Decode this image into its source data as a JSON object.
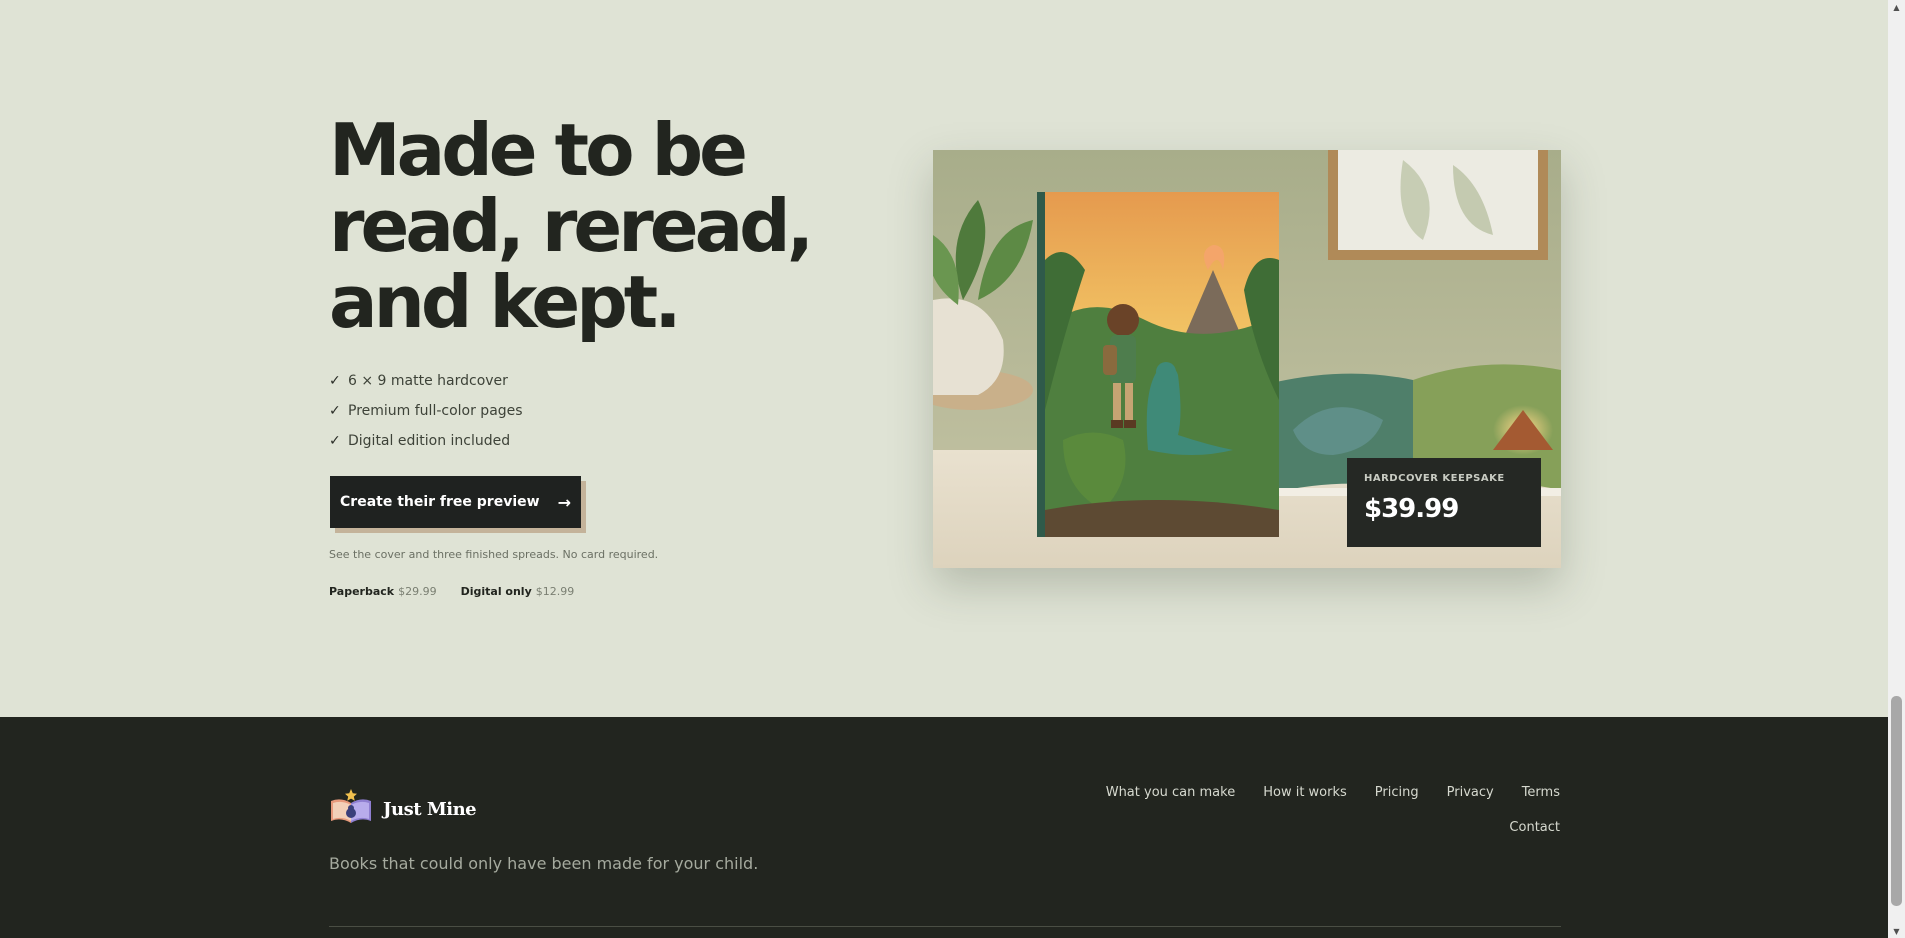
{
  "hero": {
    "headline_lines": [
      "Made to be",
      "read, reread,",
      "and kept."
    ],
    "features": [
      "6 × 9 matte hardcover",
      "Premium full-color pages",
      "Digital edition included"
    ],
    "check_glyph": "✓",
    "cta_label": "Create their free preview",
    "cta_icon": "arrow-right-icon",
    "note": "See the cover and three finished spreads. No card required.",
    "prices": [
      {
        "name": "Paperback",
        "price": "$29.99"
      },
      {
        "name": "Digital only",
        "price": "$12.99"
      }
    ],
    "image_badge": {
      "label": "HARDCOVER KEEPSAKE",
      "price": "$39.99"
    }
  },
  "footer": {
    "brand_name": "Just Mine",
    "logo_icon": "open-book-star-icon",
    "tagline": "Books that could only have been made for your child.",
    "nav_row1": [
      "What you can make",
      "How it works",
      "Pricing",
      "Privacy",
      "Terms"
    ],
    "nav_row2": [
      "Contact"
    ]
  },
  "colors": {
    "background": "#dfe3d5",
    "dark": "#22251f",
    "cta_shadow": "#c4b39a"
  }
}
